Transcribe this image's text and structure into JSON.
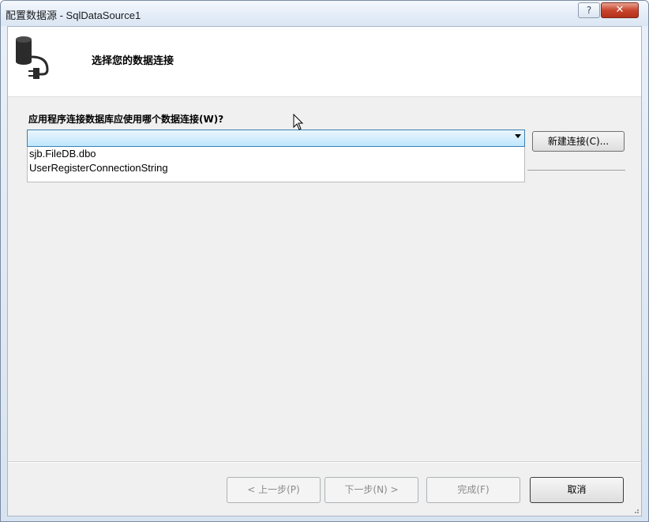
{
  "window": {
    "title": "配置数据源 - SqlDataSource1",
    "help_label": "?",
    "close_label": "✕"
  },
  "header": {
    "title": "选择您的数据连接",
    "icon": "database-connection-icon"
  },
  "main": {
    "question": "应用程序连接数据库应使用哪个数据连接(W)?",
    "connection_combo_value": "",
    "dropdown_items": [
      "sjb.FileDB.dbo",
      "UserRegisterConnectionString"
    ],
    "new_connection_label": "新建连接(C)..."
  },
  "footer": {
    "prev_label": "< 上一步(P)",
    "next_label": "下一步(N) >",
    "finish_label": "完成(F)",
    "cancel_label": "取消"
  },
  "colors": {
    "combo_border": "#3c7fb1",
    "combo_fill": "#bee6fd",
    "close_button": "#c8452d"
  }
}
